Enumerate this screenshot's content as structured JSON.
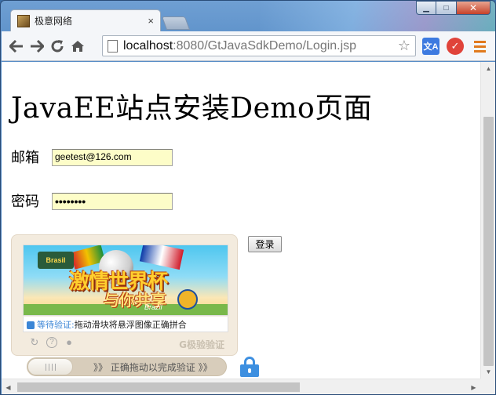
{
  "window": {
    "controls": {
      "minimize": "▁",
      "maximize": "□",
      "close": "✕"
    }
  },
  "tab": {
    "title": "极意网络",
    "close_label": "×"
  },
  "toolbar": {
    "back_icon": "arrow-left-icon",
    "forward_icon": "arrow-right-icon",
    "reload_icon": "reload-icon",
    "home_icon": "home-icon",
    "url_host": "localhost",
    "url_rest": ":8080/GtJavaSdkDemo/Login.jsp",
    "star": "☆",
    "translate_ext": "文A",
    "check_ext": "✓"
  },
  "page": {
    "heading": "JavaEE站点安装Demo页面",
    "email_label": "邮箱",
    "email_value": "geetest@126.com",
    "password_label": "密码",
    "password_value": "••••••••",
    "login_button": "登录"
  },
  "captcha": {
    "image_cup_text": "Brasil",
    "image_slogan_1": "激情世界杯",
    "image_slogan_2": "与你共享",
    "image_badge": "Brazil",
    "status_wait": "等待验证:",
    "status_tip": "拖动滑块将悬浮图像正确拼合",
    "tools": {
      "refresh": "↻",
      "help": "?",
      "feedback": "●"
    },
    "brand": "G极验验证",
    "slider_text": "》》 正确拖动以完成验证 》》",
    "slider_progress": 0
  },
  "scrollbars": {
    "up": "▲",
    "down": "▼",
    "left": "◀",
    "right": "▶"
  },
  "colors": {
    "accent_blue": "#3d8fe0",
    "input_bg": "#fdfdc8",
    "captcha_bg": "#f3ebde"
  }
}
